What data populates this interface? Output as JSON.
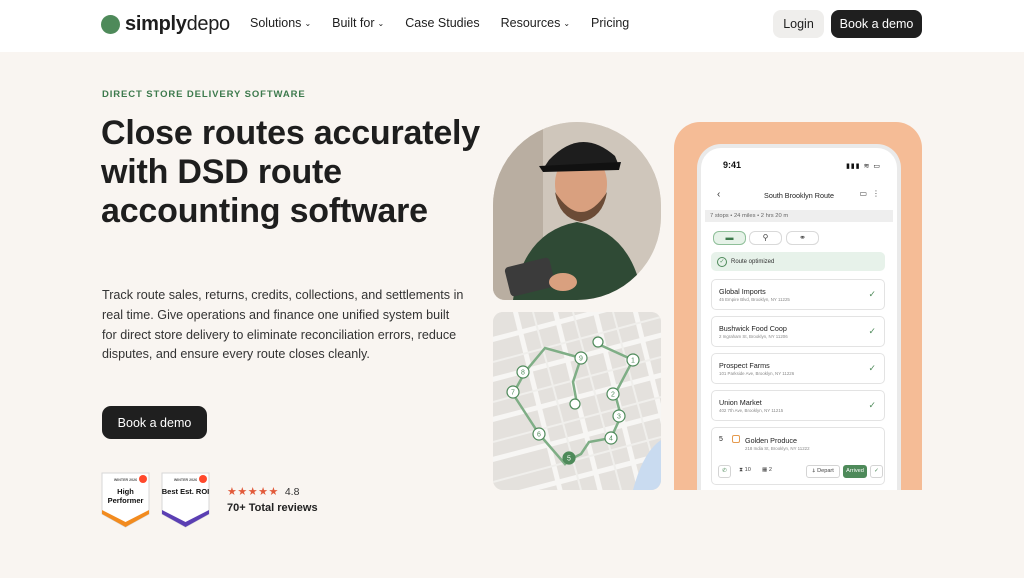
{
  "nav": {
    "logo_bold": "simply",
    "logo_light": "depo",
    "menu": [
      {
        "label": "Solutions",
        "has_dropdown": true
      },
      {
        "label": "Built for",
        "has_dropdown": true
      },
      {
        "label": "Case Studies",
        "has_dropdown": false
      },
      {
        "label": "Resources",
        "has_dropdown": true
      },
      {
        "label": "Pricing",
        "has_dropdown": false
      }
    ],
    "login_label": "Login",
    "demo_label": "Book a demo"
  },
  "hero": {
    "eyebrow": "DIRECT STORE DELIVERY SOFTWARE",
    "headline": "Close routes accurately with DSD route accounting software",
    "body": "Track route sales, returns, credits, collections, and settlements in real time. Give operations and finance one unified system built for direct store delivery to eliminate reconciliation errors, reduce disputes, and ensure every route closes cleanly.",
    "cta_label": "Book a demo"
  },
  "badges": [
    {
      "season": "WINTER 2026",
      "name": "High Performer",
      "color": "#f28b1f"
    },
    {
      "season": "WINTER 2026",
      "name": "Best Est. ROI",
      "color": "#5b3fb3"
    }
  ],
  "rating": {
    "stars": "★★★★★",
    "value": "4.8",
    "reviews": "70+ Total reviews"
  },
  "phone": {
    "time": "9:41",
    "status_icons": "▮▮▮ ≋ ▭",
    "title": "South Brooklyn Route",
    "summary": "7 stops • 24 miles • 2 hrs 20 m",
    "optimized_label": "Route optimized",
    "stops": [
      {
        "name": "Global Imports",
        "address": "45 Empire Blvd, Brooklyn, NY 11225"
      },
      {
        "name": "Bushwick Food Coop",
        "address": "2 Ingraham St, Brooklyn, NY 11206"
      },
      {
        "name": "Prospect Farms",
        "address": "101 Parkside Ave, Brooklyn, NY 11226"
      },
      {
        "name": "Union Market",
        "address": "402 7th Ave, Brooklyn, NY 11215"
      }
    ],
    "current_stop": {
      "number": "5",
      "name": "Golden Produce",
      "address": "218 India St, Brooklyn, NY 11222",
      "count_a": "10",
      "count_b": "2",
      "depart_label": "Depart",
      "arrived_label": "Arrived"
    }
  }
}
